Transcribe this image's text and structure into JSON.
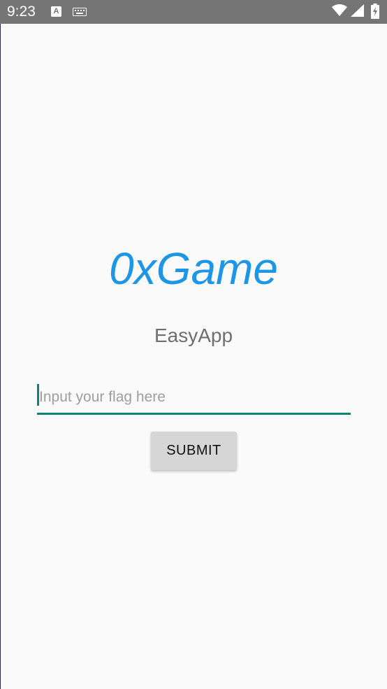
{
  "status_bar": {
    "time": "9:23",
    "a_icon_letter": "A",
    "icons": [
      "a-notification-icon",
      "keyboard-icon",
      "wifi-icon",
      "signal-icon",
      "battery-icon"
    ],
    "background": "#757575"
  },
  "app": {
    "title": "0xGame",
    "subtitle": "EasyApp",
    "flag_input": {
      "value": "",
      "placeholder": "Input your flag here"
    },
    "submit_label": "SUBMIT"
  },
  "colors": {
    "title": "#1e96e8",
    "accent": "#118077",
    "button": "#d6d6d6",
    "background": "#fafafa"
  }
}
